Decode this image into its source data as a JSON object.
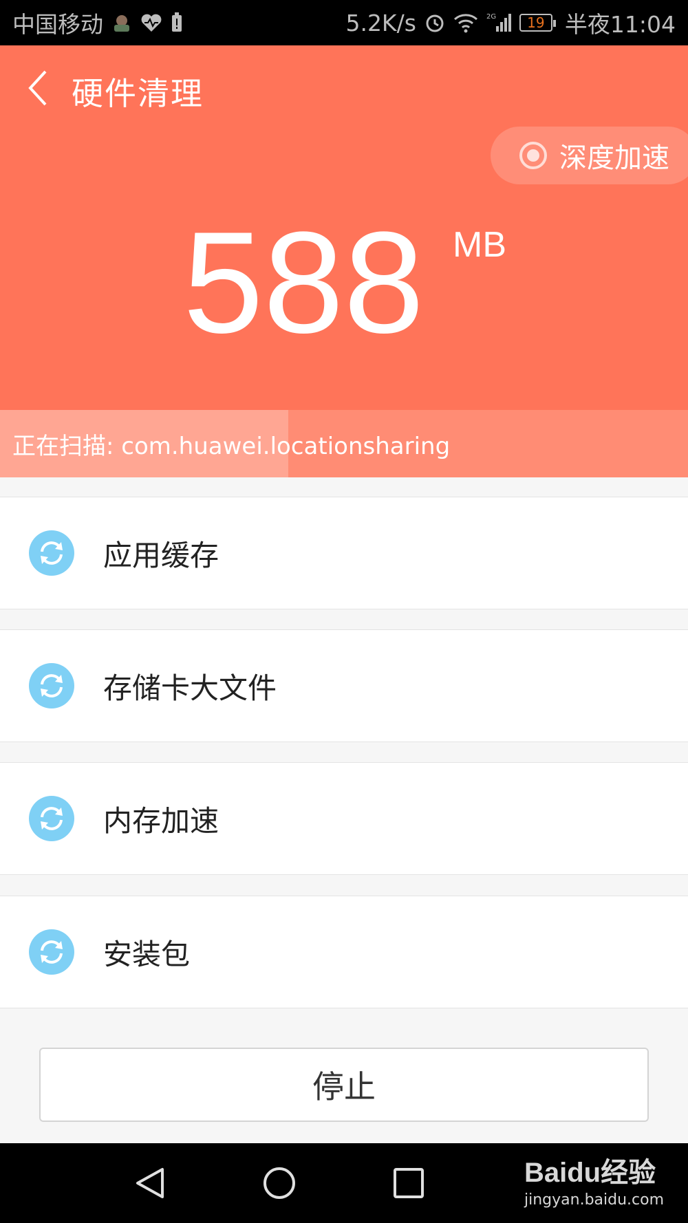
{
  "status_bar": {
    "carrier": "中国移动",
    "net_speed": "5.2K/s",
    "network_type": "2G",
    "battery": "19",
    "time": "半夜11:04"
  },
  "header": {
    "title": "硬件清理",
    "deep_boost_label": "深度加速",
    "size_value": "588",
    "size_unit": "MB",
    "background_color": "#ff7459"
  },
  "scan": {
    "text": "正在扫描: com.huawei.locationsharing"
  },
  "items": [
    {
      "label": "应用缓存",
      "icon": "refresh-icon"
    },
    {
      "label": "存储卡大文件",
      "icon": "refresh-icon"
    },
    {
      "label": "内存加速",
      "icon": "refresh-icon"
    },
    {
      "label": "安装包",
      "icon": "refresh-icon"
    }
  ],
  "stop_button_label": "停止",
  "watermark": {
    "main": "Baidu经验",
    "sub": "jingyan.baidu.com"
  },
  "colors": {
    "accent": "#ff7459",
    "item_icon": "#7fd0f5"
  }
}
